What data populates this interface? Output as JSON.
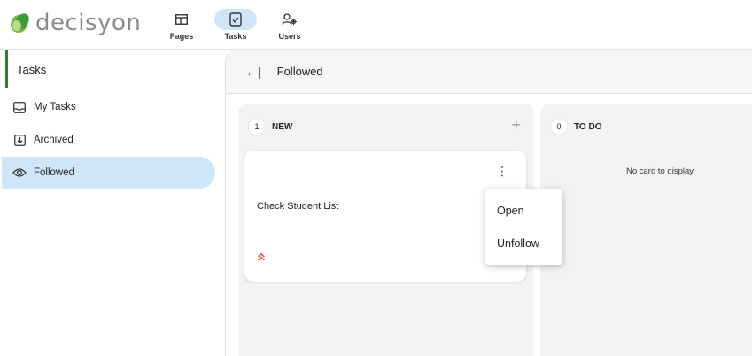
{
  "app": {
    "logo_text": "decisyon"
  },
  "nav": [
    {
      "label": "Pages",
      "icon": "pages-icon"
    },
    {
      "label": "Tasks",
      "icon": "tasks-icon"
    },
    {
      "label": "Users",
      "icon": "users-icon"
    }
  ],
  "sidebar": {
    "header": "Tasks",
    "items": [
      {
        "label": "My Tasks",
        "icon": "inbox-icon"
      },
      {
        "label": "Archived",
        "icon": "archive-icon"
      },
      {
        "label": "Followed",
        "icon": "eye-icon"
      }
    ]
  },
  "main": {
    "back_glyph": "←|",
    "title": "Followed",
    "columns": [
      {
        "count": "1",
        "title": "NEW",
        "add_glyph": "+",
        "cards": [
          {
            "title": "Check Student List",
            "menu_glyph": "⋮",
            "priority": "high"
          }
        ]
      },
      {
        "count": "0",
        "title": "TO DO",
        "empty_text": "No card to display"
      }
    ]
  },
  "context_menu": {
    "items": [
      "Open",
      "Unfollow"
    ]
  },
  "colors": {
    "accent": "#cfe6f9",
    "brand_green": "#2e7d32",
    "priority_red": "#e53935"
  }
}
